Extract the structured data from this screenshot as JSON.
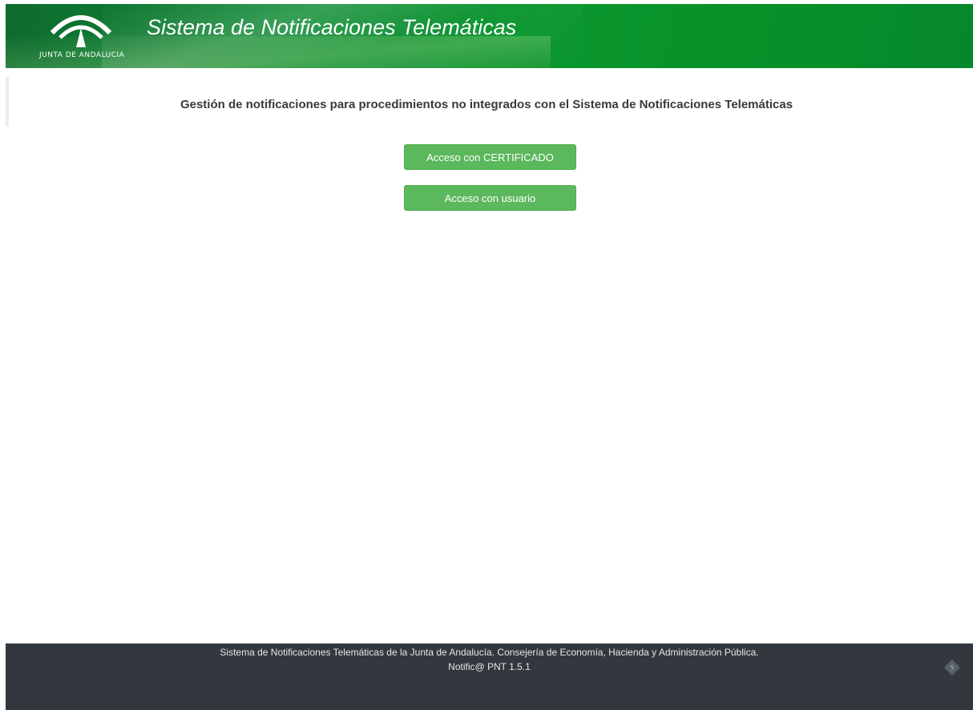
{
  "header": {
    "logo_text": "JUNTA DE ANDALUCIA",
    "app_title": "Sistema de Notificaciones Telemáticas",
    "brand_color": "#0a962e"
  },
  "main": {
    "subtitle": "Gestión de notificaciones para procedimientos no integrados con el Sistema de Notificaciones Telemáticas",
    "buttons": {
      "certificate_label": "Acceso con CERTIFICADO",
      "user_label": "Acceso con usuario"
    },
    "button_color": "#5cb85c"
  },
  "footer": {
    "line1": "Sistema de Notificaciones Telemáticas de la Junta de Andalucía.  Consejería de Economía, Hacienda y Administración Pública.",
    "line2": "Notific@ PNT 1.5.1",
    "background_color": "#33383f",
    "badge_icon": "diamond-badge-icon"
  }
}
